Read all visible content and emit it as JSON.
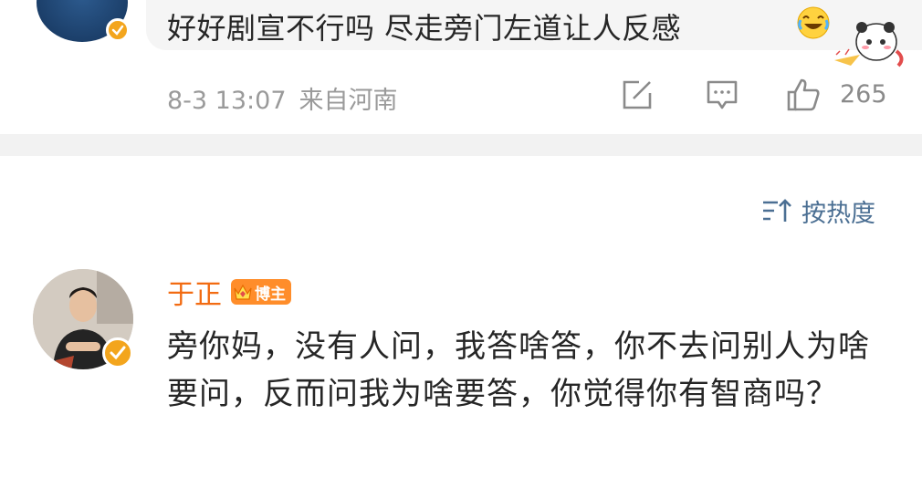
{
  "top_post": {
    "comment_text": "好好剧宣不行吗 尽走旁门左道让人反感",
    "date": "8-3 13:07",
    "location": "来自河南",
    "like_count": "265"
  },
  "sort": {
    "label": "按热度"
  },
  "comment": {
    "author_name": "于正",
    "badge_text": "博主",
    "text": "旁你妈，没有人问，我答啥答，你不去问别人为啥要问，反而问我为啥要答，你觉得你有智商吗？"
  },
  "colors": {
    "author_name": "#f26b12",
    "sort_link": "#4b6f93",
    "meta_text": "#9a9a9a",
    "verified_badge": "#f3a51d"
  },
  "icons": [
    "verified-badge-icon",
    "laughing-emoji-icon",
    "panda-sticker-icon",
    "share-icon",
    "comment-icon",
    "like-icon",
    "sort-icon",
    "crown-icon"
  ]
}
